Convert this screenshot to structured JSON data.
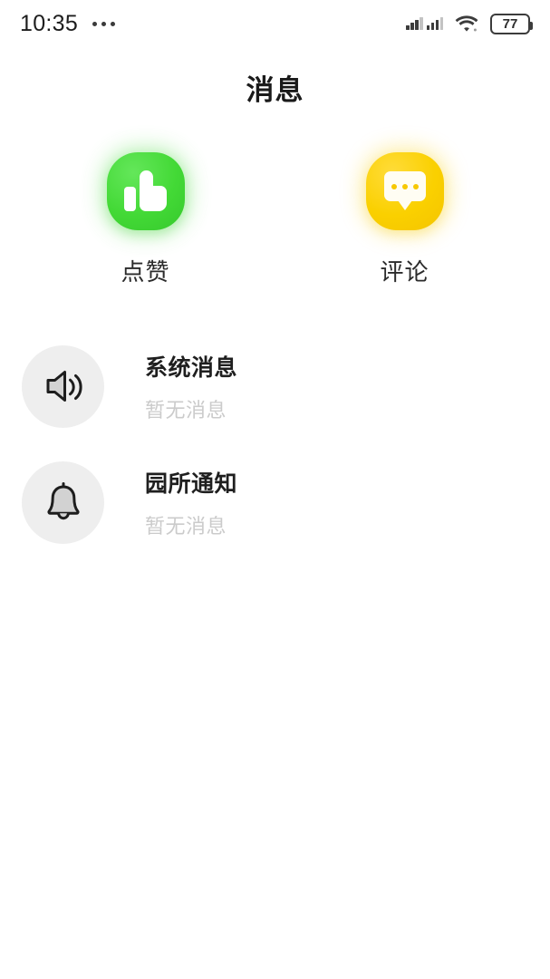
{
  "statusbar": {
    "time": "10:35",
    "menu_icon": "more-dots-icon",
    "signal_icon": "cellular-signal-icon",
    "wifi_icon": "wifi-icon",
    "battery_level": "77",
    "battery_icon": "battery-icon"
  },
  "header": {
    "title": "消息"
  },
  "shortcuts": [
    {
      "label": "点赞",
      "icon": "thumbs-up-icon",
      "color": "#43d936",
      "name": "likes"
    },
    {
      "label": "评论",
      "icon": "comment-bubble-icon",
      "color": "#fad000",
      "name": "comments"
    }
  ],
  "messages": [
    {
      "title": "系统消息",
      "subtitle": "暂无消息",
      "icon": "speaker-icon"
    },
    {
      "title": "园所通知",
      "subtitle": "暂无消息",
      "icon": "bell-icon"
    }
  ]
}
